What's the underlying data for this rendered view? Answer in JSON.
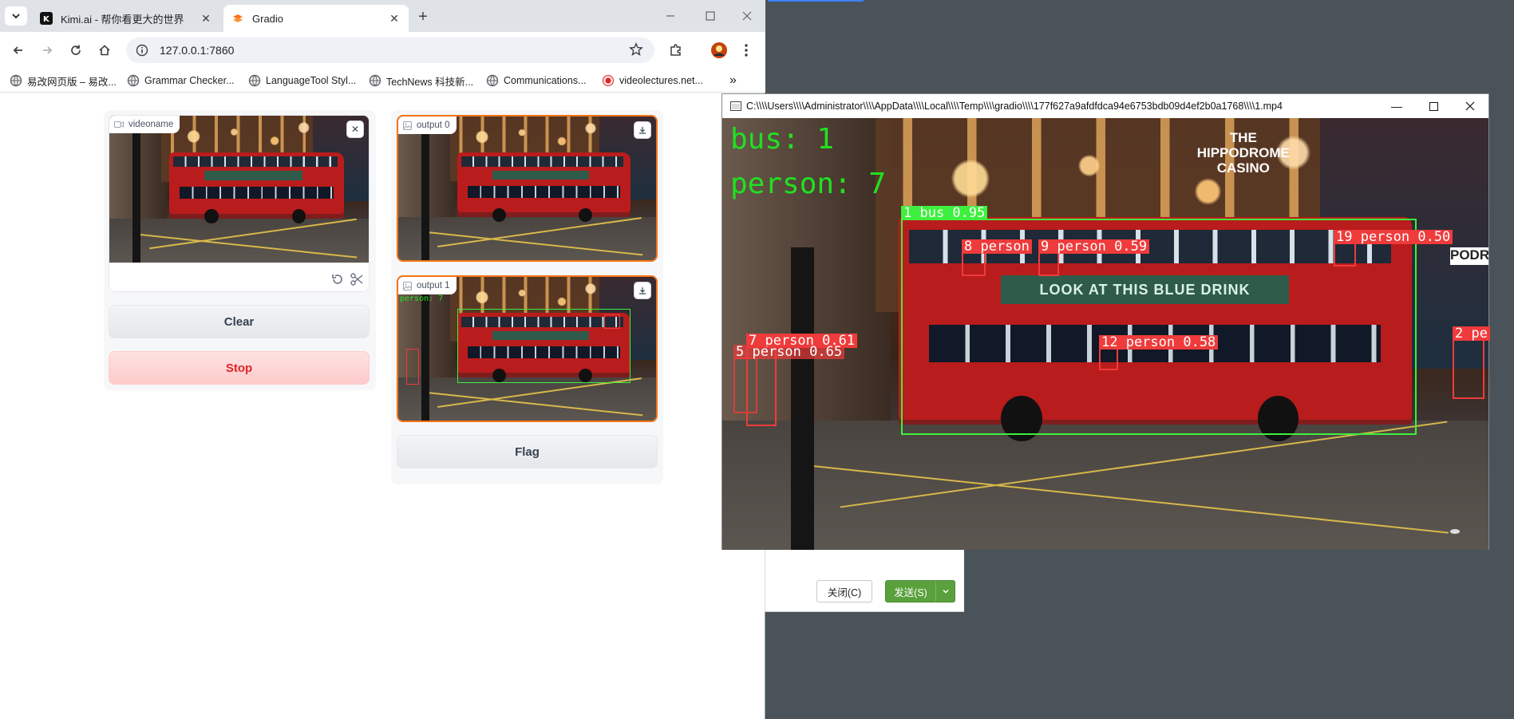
{
  "browser": {
    "tabs": [
      {
        "title": "Kimi.ai - 帮你看更大的世界",
        "favicon": "kimi-icon",
        "active": false
      },
      {
        "title": "Gradio",
        "favicon": "gradio-icon",
        "active": true
      }
    ],
    "url": "127.0.0.1:7860",
    "bookmarks": [
      {
        "label": "易改网页版 – 易改...",
        "icon": "globe-icon"
      },
      {
        "label": "Grammar Checker...",
        "icon": "globe-icon"
      },
      {
        "label": "LanguageTool Styl...",
        "icon": "globe-icon"
      },
      {
        "label": "TechNews 科技新...",
        "icon": "globe-icon"
      },
      {
        "label": "Communications...",
        "icon": "globe-icon"
      },
      {
        "label": "videolectures.net...",
        "icon": "record-icon"
      }
    ],
    "more_bookmarks": "»"
  },
  "gradio": {
    "input_label": "videoname",
    "clear_label": "Clear",
    "stop_label": "Stop",
    "output0_label": "output 0",
    "output1_label": "output 1",
    "flag_label": "Flag",
    "out1_count_text": "person: 7",
    "out1_sign": "THE HIPPODROME CASINO"
  },
  "player": {
    "title": "C:\\\\\\\\Users\\\\\\\\Administrator\\\\\\\\AppData\\\\\\\\Local\\\\\\\\Temp\\\\\\\\gradio\\\\\\\\177f627a9afdfdca94e6753bdb09d4ef2b0a1768\\\\\\\\1.mp4",
    "counts": [
      "bus: 1",
      "person: 7"
    ],
    "detections": [
      {
        "label": "1 bus 0.95",
        "color": "green"
      },
      {
        "label": "8 person",
        "color": "red"
      },
      {
        "label": "9 person 0.59",
        "color": "red"
      },
      {
        "label": "19 person 0.50",
        "color": "red"
      },
      {
        "label": "7 person 0.61",
        "color": "red"
      },
      {
        "label": "5 person 0.65",
        "color": "red"
      },
      {
        "label": "12 person 0.58",
        "color": "red"
      },
      {
        "label": "2 pe",
        "color": "red"
      }
    ],
    "sign_text": "THE HIPPODROME CASINO",
    "bus_ad": "LOOK AT THIS BLUE DRINK",
    "shop_sign": "PODROMI"
  },
  "dialog": {
    "close_label": "关闭(C)",
    "send_label": "发送(S)"
  },
  "colors": {
    "detect_green": "#3df03d",
    "detect_red": "#ef3b3b",
    "stop_text": "#dc2626",
    "send_green": "#5aa03c"
  }
}
